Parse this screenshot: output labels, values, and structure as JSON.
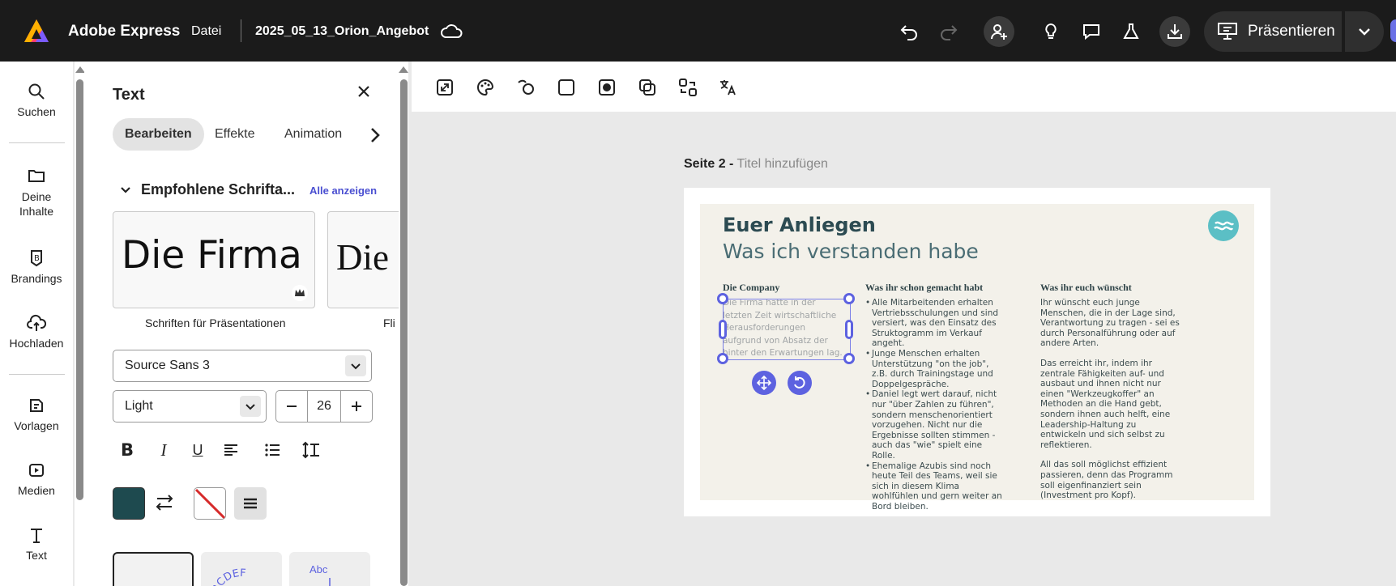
{
  "header": {
    "app_name": "Adobe Express",
    "file_menu": "Datei",
    "document_name": "2025_05_13_Orion_Angebot",
    "present_label": "Präsentieren"
  },
  "rail": {
    "items": [
      {
        "label": "Suchen",
        "icon": "search-icon"
      },
      {
        "label": "Deine Inhalte",
        "icon": "folder-icon"
      },
      {
        "label": "Brandings",
        "icon": "brand-icon"
      },
      {
        "label": "Hochladen",
        "icon": "upload-cloud-icon"
      },
      {
        "label": "Vorlagen",
        "icon": "templates-icon"
      },
      {
        "label": "Medien",
        "icon": "media-icon"
      },
      {
        "label": "Text",
        "icon": "text-icon"
      }
    ]
  },
  "panel": {
    "title": "Text",
    "tabs": [
      "Bearbeiten",
      "Effekte",
      "Animation"
    ],
    "section_title": "Empfohlene Schrifta...",
    "see_all": "Alle anzeigen",
    "font_cards": [
      {
        "sample": "Die Firma ha",
        "label": "Schriften für Präsentationen"
      },
      {
        "sample": "Die",
        "label": "Fli"
      }
    ],
    "font_family": "Source Sans 3",
    "font_weight": "Light",
    "font_size": "26",
    "text_color": "#1e4a4f",
    "effect_samples": [
      "ABCDEF",
      "Abc"
    ]
  },
  "canvas": {
    "page_label": "Seite 2 -",
    "page_title_placeholder": "Titel hinzufügen",
    "slide": {
      "title": "Euer Anliegen",
      "subtitle": "Was ich verstanden habe",
      "columns": [
        {
          "heading": "Die Company",
          "text": "Die Firma hatte in der letzten Zeit wirtschaftliche Herausforderungen aufgrund von Absatz der hinter den Erwartungen lag."
        },
        {
          "heading": "Was ihr schon gemacht habt",
          "bullets": [
            "Alle Mitarbeitenden erhalten Vertriebsschulungen und sind versiert, was den Einsatz des Struktogramm im Verkauf angeht.",
            "Junge Menschen erhalten Unterstützung \"on the job\", z.B. durch Trainingstage und Doppelgespräche.",
            "Daniel legt wert darauf, nicht nur \"über Zahlen zu führen\", sondern menschenorientiert vorzugehen. Nicht nur die Ergebnisse sollten stimmen - auch das \"wie\" spielt eine Rolle.",
            "Ehemalige Azubis sind noch heute Teil des Teams, weil sie sich in diesem Klima wohlfühlen und gern weiter an Bord bleiben."
          ]
        },
        {
          "heading": "Was ihr euch wünscht",
          "paragraphs": [
            "Ihr wünscht euch junge Menschen, die in der Lage sind, Verantwortung zu tragen - sei es durch Personalführung oder auf andere Arten.",
            "Das erreicht ihr, indem ihr zentrale Fähigkeiten auf- und ausbaut und ihnen nicht nur einen \"Werkzeugkoffer\" an Methoden an die Hand gebt, sondern ihnen auch helft, eine Leadership-Haltung zu entwickeln und sich selbst zu reflektieren.",
            "All das soll möglichst effizient passieren, denn das Programm soll eigenfinanziert sein (Investment pro Kopf)."
          ]
        }
      ]
    }
  },
  "colors": {
    "accent": "#5d62e0",
    "topbar": "#1b1b1b",
    "slide_bg": "#f3f1ea",
    "logo_teal": "#5bbfc5"
  }
}
